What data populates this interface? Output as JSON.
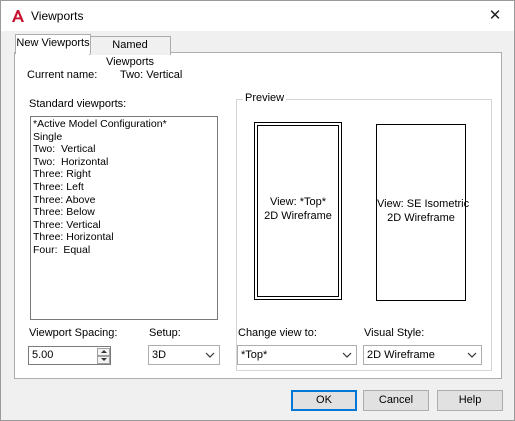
{
  "window": {
    "title": "Viewports",
    "close_glyph": "✕",
    "app_icon": "autocad-a-icon",
    "accent": "#c8102e"
  },
  "tabs": [
    {
      "label": "New Viewports",
      "active": true
    },
    {
      "label": "Named Viewports",
      "active": false
    }
  ],
  "current_name": {
    "label": "Current name:",
    "value": "Two:  Vertical"
  },
  "standard_viewports": {
    "label": "Standard viewports:",
    "items": [
      "*Active Model Configuration*",
      "Single",
      "Two:  Vertical",
      "Two:  Horizontal",
      "Three: Right",
      "Three: Left",
      "Three: Above",
      "Three: Below",
      "Three: Vertical",
      "Three: Horizontal",
      "Four:  Equal"
    ]
  },
  "preview": {
    "label": "Preview",
    "viewports": [
      {
        "line1": "View: *Top*",
        "line2": "2D Wireframe",
        "selected": true
      },
      {
        "line1": "View: SE Isometric",
        "line2": "2D Wireframe",
        "selected": false
      }
    ]
  },
  "viewport_spacing": {
    "label": "Viewport Spacing:",
    "value": "5.00"
  },
  "setup": {
    "label": "Setup:",
    "value": "3D"
  },
  "change_view": {
    "label": "Change view to:",
    "value": "*Top*"
  },
  "visual_style": {
    "label": "Visual Style:",
    "value": "2D Wireframe"
  },
  "buttons": {
    "ok": "OK",
    "cancel": "Cancel",
    "help": "Help"
  }
}
